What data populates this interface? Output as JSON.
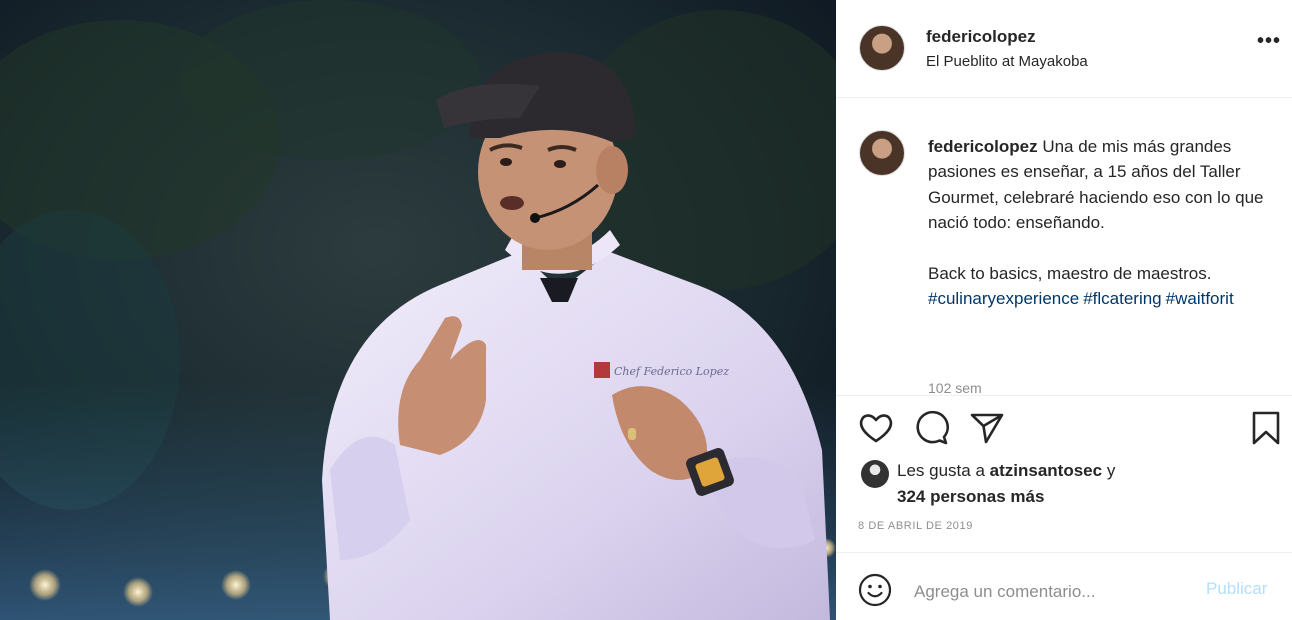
{
  "post": {
    "username": "federicolopez",
    "location": "El Pueblito at Mayakoba",
    "more_icon": "more-options-icon",
    "more_label": "•••"
  },
  "caption": {
    "username": "federicolopez",
    "paragraph1": "Una de mis más grandes pasiones es enseñar, a 15 años del Taller Gourmet, celebraré haciendo eso con lo que nació todo: enseñando.",
    "paragraph2": "Back to basics, maestro de maestros.",
    "hashtags": [
      "#culinaryexperience",
      "#flcatering",
      "#waitforit"
    ],
    "time_ago": "102 sem"
  },
  "actions": {
    "icons": [
      "heart-icon",
      "comment-icon",
      "share-icon",
      "bookmark-icon"
    ]
  },
  "likes": {
    "prefix": "Les gusta a",
    "liker": "atzinsantosec",
    "connector": "y",
    "others": "324 personas más"
  },
  "date": "8 DE ABRIL DE 2019",
  "comment": {
    "placeholder": "Agrega un comentario...",
    "publish_label": "Publicar"
  },
  "photo": {
    "jacket_embroidery": "Chef Federico Lopez"
  },
  "colors": {
    "hashtag": "#00376b",
    "publish": "#b2dffc",
    "muted": "#8e8e8e",
    "text": "#262626"
  }
}
